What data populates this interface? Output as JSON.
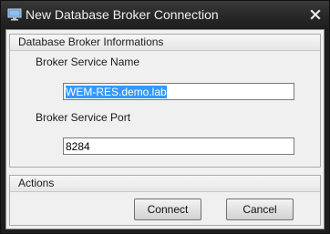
{
  "window": {
    "title": "New Database Broker Connection",
    "icon": "monitor-icon"
  },
  "broker_info": {
    "header": "Database Broker Informations",
    "service_name_label": "Broker Service Name",
    "service_name_value": "WEM-RES.demo.lab",
    "service_port_label": "Broker Service Port",
    "service_port_value": "8284"
  },
  "actions": {
    "header": "Actions",
    "connect_label": "Connect",
    "cancel_label": "Cancel"
  },
  "colors": {
    "titlebar": "#1e1e1e",
    "selection": "#3399ff",
    "panel": "#f0f0f0"
  }
}
